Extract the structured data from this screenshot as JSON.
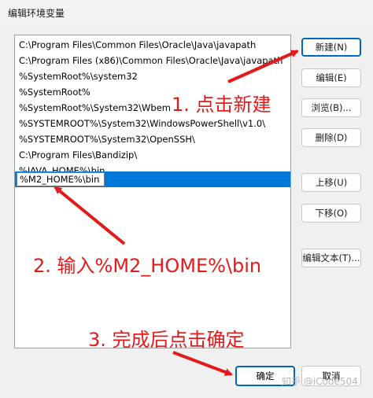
{
  "window": {
    "title": "编辑环境变量"
  },
  "paths": [
    "C:\\Program Files\\Common Files\\Oracle\\Java\\javapath",
    "C:\\Program Files (x86)\\Common Files\\Oracle\\Java\\javapath",
    "%SystemRoot%\\system32",
    "%SystemRoot%",
    "%SystemRoot%\\System32\\Wbem",
    "%SYSTEMROOT%\\System32\\WindowsPowerShell\\v1.0\\",
    "%SYSTEMROOT%\\System32\\OpenSSH\\",
    "C:\\Program Files\\Bandizip\\",
    "%JAVA_HOME%\\bin"
  ],
  "editing_value": "%M2_HOME%\\bin",
  "buttons": {
    "new": "新建(N)",
    "edit": "编辑(E)",
    "browse": "浏览(B)...",
    "delete": "删除(D)",
    "move_up": "上移(U)",
    "move_down": "下移(O)",
    "edit_text": "编辑文本(T)...",
    "ok": "确定",
    "cancel": "取消"
  },
  "annotations": {
    "step1": "1. 点击新建",
    "step2": "2. 输入%M2_HOME%\\bin",
    "step3": "3. 完成后点击确定"
  },
  "watermark": "知乎 @iCode504",
  "colors": {
    "selection": "#0078d7",
    "annotation": "#e21a1a",
    "default_button_border": "#0067c0"
  }
}
